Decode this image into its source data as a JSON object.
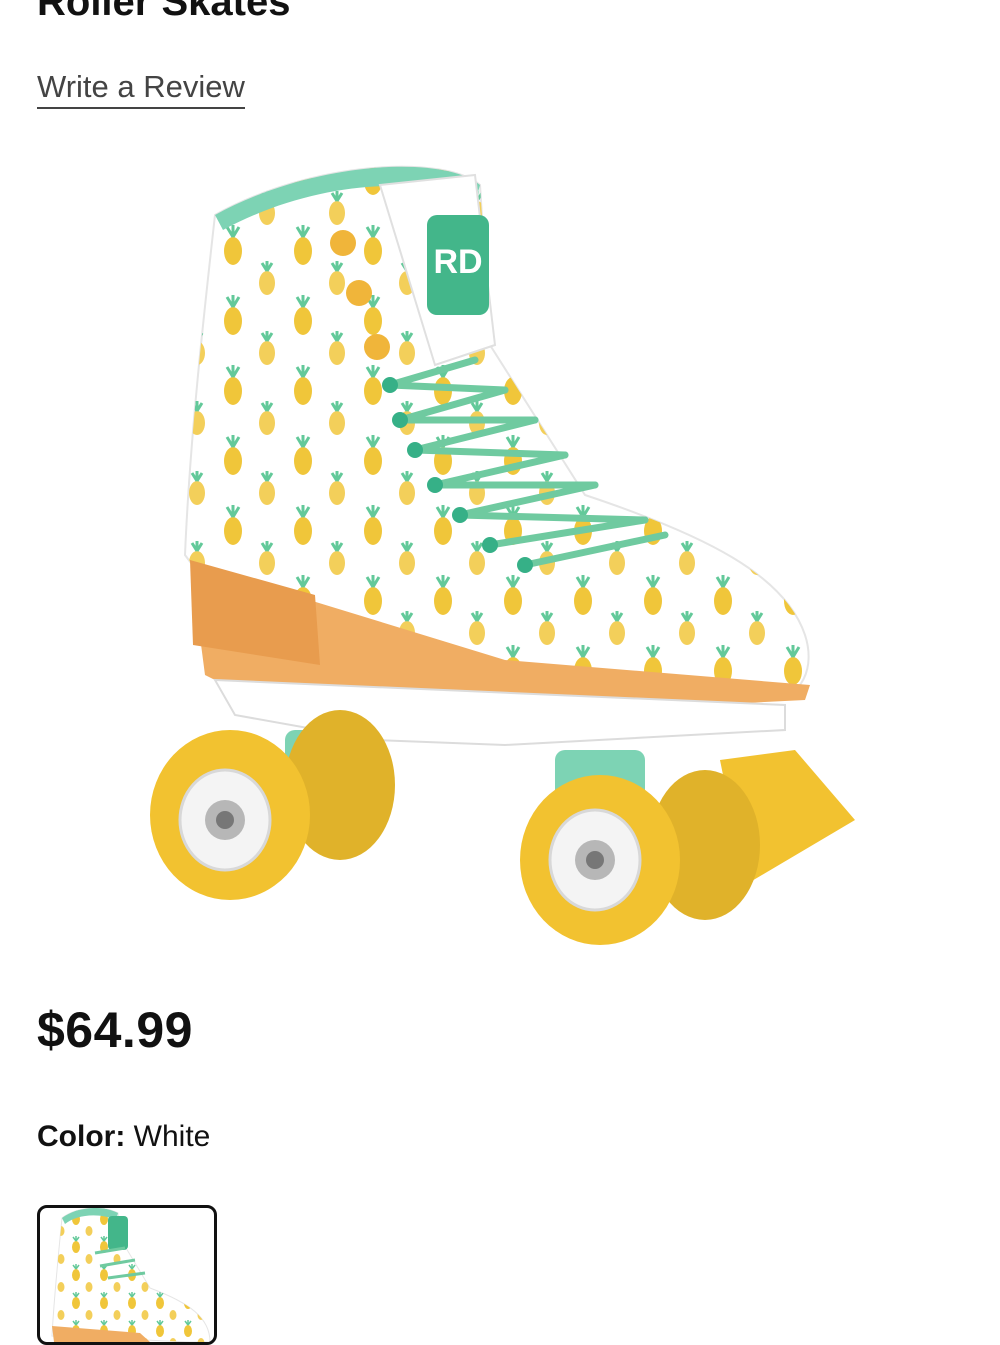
{
  "product": {
    "title": "Roller Skates",
    "review_link": "Write a Review",
    "image_name": "roller-skate-pineapple",
    "logo_text": "RD",
    "price": "$64.99",
    "color_label": "Color:",
    "color_value": "White"
  },
  "colors": {
    "mint": "#7dd3b4",
    "pineapple": "#f0c63a",
    "sole": "#f0ad63",
    "wheel": "#f2c230",
    "text": "#111111",
    "link": "#444444"
  }
}
